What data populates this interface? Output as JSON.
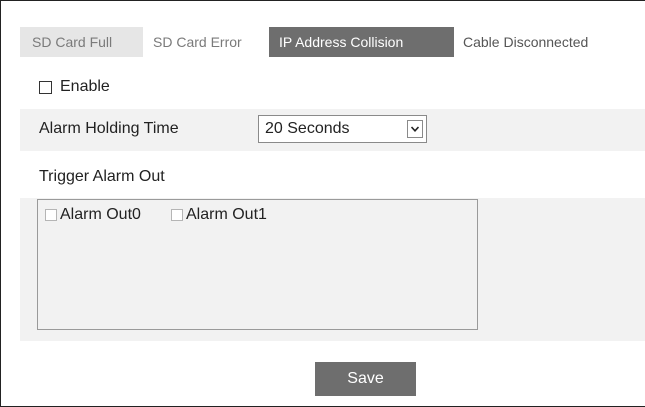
{
  "tabs": [
    {
      "label": "SD Card Full",
      "active": false
    },
    {
      "label": "SD Card Error",
      "active": false
    },
    {
      "label": "IP Address Collision",
      "active": true
    },
    {
      "label": "Cable Disconnected",
      "active": false
    }
  ],
  "enable": {
    "label": "Enable",
    "checked": false
  },
  "alarm_holding": {
    "label": "Alarm Holding Time",
    "value": "20 Seconds"
  },
  "trigger": {
    "label": "Trigger Alarm Out",
    "outputs": [
      {
        "label": "Alarm Out0",
        "checked": false
      },
      {
        "label": "Alarm Out1",
        "checked": false
      }
    ]
  },
  "save_label": "Save",
  "colors": {
    "active_tab": "#6e6e6e",
    "tab_gray": "#e6e6e6",
    "band": "#f2f2f2",
    "button": "#6e6e6e"
  }
}
